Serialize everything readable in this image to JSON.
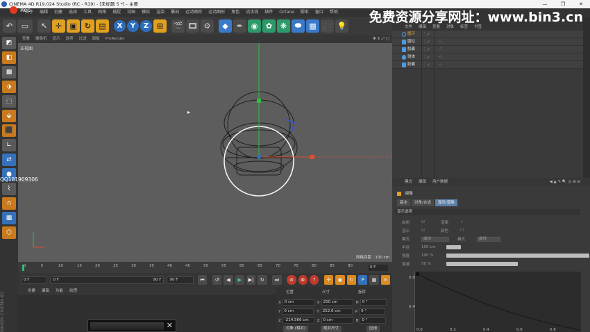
{
  "window": {
    "title": "CINEMA 4D R19.024 Studio (RC - R19) - [未标题 5 *] - 主要",
    "controls": [
      "—",
      "❐",
      "✕"
    ]
  },
  "recorder": {
    "label": "Rec"
  },
  "watermark": "免费资源分享网址：www.bin3.cn",
  "menu": [
    "文件",
    "编辑",
    "创建",
    "选择",
    "工具",
    "网格",
    "捕捉",
    "动画",
    "模拟",
    "渲染",
    "雕刻",
    "运动跟踪",
    "运动图形",
    "角色",
    "流水线",
    "插件",
    "Octane",
    "脚本",
    "窗口",
    "帮助"
  ],
  "toolbar": {
    "axes": [
      "X",
      "Y",
      "Z"
    ]
  },
  "viewport": {
    "menu": [
      "查看",
      "摄像机",
      "显示",
      "选项",
      "过滤",
      "面板",
      "ProRender"
    ],
    "label": "正视图",
    "grid_spacing": "网格间距 : 100 cm",
    "nav_icons": "✥ ⇕ ⤢ ▢"
  },
  "overlay": {
    "qq": "QQ181909306"
  },
  "timeline": {
    "ticks": [
      "0",
      "5",
      "10",
      "15",
      "20",
      "25",
      "30",
      "35",
      "40",
      "45",
      "50",
      "55",
      "60",
      "65",
      "70",
      "75",
      "80",
      "85",
      "90"
    ],
    "end_frame": "0 F"
  },
  "transport": {
    "current_frame": "0 F",
    "start_frame": "0 F",
    "range_end": "90 F",
    "end_frame": "90 F"
  },
  "material": {
    "menu": [
      "创建",
      "编辑",
      "功能",
      "纹理"
    ]
  },
  "coords": {
    "headers": [
      "位置",
      "尺寸",
      "旋转"
    ],
    "rows": [
      {
        "axis": "X",
        "pos": "0 cm",
        "size_axis": "X",
        "size": "250 cm",
        "rot_axis": "H",
        "rot": "0 °"
      },
      {
        "axis": "Y",
        "pos": "0 cm",
        "size_axis": "Y",
        "size": "252.6 cm",
        "rot_axis": "P",
        "rot": "0 °"
      },
      {
        "axis": "Z",
        "pos": "-214.566 cm",
        "size_axis": "Z",
        "size": "0 cm",
        "rot_axis": "B",
        "rot": "0 °"
      }
    ],
    "mode": "对象 (相对)",
    "size_mode": "绝对尺寸",
    "apply": "应用"
  },
  "objects": {
    "menu": [
      "文件",
      "编辑",
      "查看",
      "对象",
      "标签",
      "书签"
    ],
    "items": [
      "圆环",
      "圆柱",
      "胶囊",
      "球体",
      "胶囊"
    ]
  },
  "attributes": {
    "menu": [
      "模式",
      "编辑",
      "用户数据"
    ],
    "controls": "◀ ▲ ✎ 🔍 ◎ ⊞ ⊟",
    "object_name": "摄像",
    "tabs": [
      "基本",
      "对象/合成",
      "显示/渲染"
    ],
    "active_tab": 2,
    "section": "显示选项",
    "rows": [
      {
        "label": "启用",
        "value": "☑",
        "label2": "渲染",
        "value2": "✓"
      },
      {
        "label": "显示",
        "value": "☑",
        "label2": "颜色",
        "value2": "☐"
      },
      {
        "label": "模式",
        "value": "曲线",
        "label2": "模式",
        "value2": "曲线"
      },
      {
        "label": "半径",
        "value": "100 cm"
      },
      {
        "label": "强度",
        "value": "100 %"
      },
      {
        "label": "衰减",
        "value": "50 %"
      }
    ],
    "slider_levels": [
      0.1,
      1.0,
      0.5
    ],
    "graph": {
      "y_ticks": [
        "0.8",
        "0.4"
      ],
      "x_ticks": [
        "0.0",
        "0.2",
        "0.4",
        "0.6",
        "0.8"
      ]
    }
  },
  "maxon": "MAXON CINEMA 4D",
  "colors": {
    "accent_blue": "#2d6fbf",
    "axis_green": "#2fbf3f",
    "axis_red": "#e0502a",
    "rec_red": "#e03a20",
    "tag_orange": "#e0902a"
  }
}
